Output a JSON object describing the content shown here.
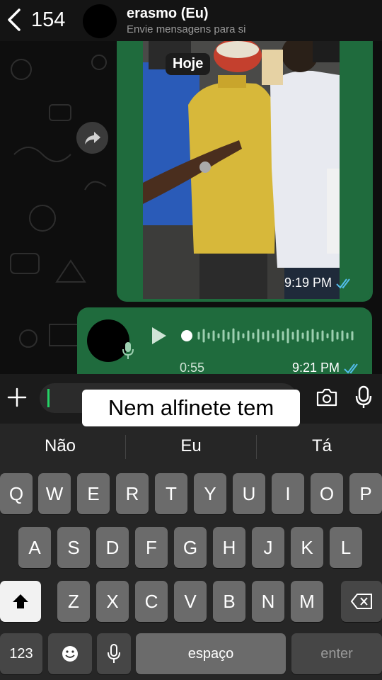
{
  "header": {
    "back_count": "154",
    "contact_name": "erasmo (Eu)",
    "contact_subtitle": "Envie mensagens para si"
  },
  "chat": {
    "date_pill": "Hoje",
    "image_message": {
      "time": "9:19 PM"
    },
    "audio_message": {
      "duration": "0:55",
      "time": "9:21 PM"
    }
  },
  "caption_overlay": "Nem alfinete tem",
  "keyboard": {
    "suggestions": [
      "Não",
      "Eu",
      "Tá"
    ],
    "row1": [
      "Q",
      "W",
      "E",
      "R",
      "T",
      "Y",
      "U",
      "I",
      "O",
      "P"
    ],
    "row2": [
      "A",
      "S",
      "D",
      "F",
      "G",
      "H",
      "J",
      "K",
      "L"
    ],
    "row3": [
      "Z",
      "X",
      "C",
      "V",
      "B",
      "N",
      "M"
    ],
    "numbers_label": "123",
    "space_label": "espaço",
    "enter_label": "enter"
  },
  "colors": {
    "bubble_green": "#1f6b3d",
    "read_ticks": "#53bdeb",
    "accent_green": "#25d366"
  },
  "icons": {
    "back": "chevron-left-icon",
    "forward": "forward-arrow-icon",
    "play": "play-icon",
    "mic": "microphone-icon",
    "camera": "camera-icon",
    "plus": "plus-icon",
    "shift": "shift-icon",
    "backspace": "backspace-icon",
    "emoji": "emoji-icon",
    "dictation": "dictation-mic-icon"
  }
}
